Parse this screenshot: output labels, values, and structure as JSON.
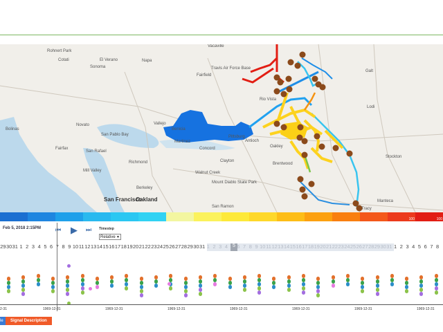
{
  "map": {
    "places": [
      {
        "label": "Rohnert Park"
      },
      {
        "label": "Cotati"
      },
      {
        "label": "El Verano"
      },
      {
        "label": "Sonoma"
      },
      {
        "label": "Napa"
      },
      {
        "label": "Vacaville"
      },
      {
        "label": "Fairfield"
      },
      {
        "label": "Travis Air Force Base"
      },
      {
        "label": "Rio Vista"
      },
      {
        "label": "Galt"
      },
      {
        "label": "Lodi"
      },
      {
        "label": "Benicia"
      },
      {
        "label": "Martinez"
      },
      {
        "label": "Pittsburg"
      },
      {
        "label": "Antioch"
      },
      {
        "label": "Oakley"
      },
      {
        "label": "Brentwood"
      },
      {
        "label": "Stockton"
      },
      {
        "label": "San Pablo Bay"
      },
      {
        "label": "San Rafael"
      },
      {
        "label": "Mill Valley"
      },
      {
        "label": "Richmond"
      },
      {
        "label": "Berkeley"
      },
      {
        "label": "Concord"
      },
      {
        "label": "Clayton"
      },
      {
        "label": "Walnut Creek"
      },
      {
        "label": "Mount Diablo State Park"
      },
      {
        "label": "San Francisco"
      },
      {
        "label": "Oakland"
      },
      {
        "label": "San Ramon"
      },
      {
        "label": "Manteca"
      },
      {
        "label": "Tracy"
      },
      {
        "label": "Bolinas"
      },
      {
        "label": "Fairfax"
      },
      {
        "label": "Novato"
      },
      {
        "label": "Vallejo"
      }
    ]
  },
  "colorbar": {
    "segments": [
      {
        "color": "#1b6fd1",
        "label": ""
      },
      {
        "color": "#1f86e0",
        "label": ""
      },
      {
        "color": "#1fa0ea",
        "label": ""
      },
      {
        "color": "#29b9ef",
        "label": ""
      },
      {
        "color": "#2bc7f2",
        "label": ""
      },
      {
        "color": "#31d2f3",
        "label": ""
      },
      {
        "color": "#f3f6a0",
        "label": ""
      },
      {
        "color": "#fbf25c",
        "label": ""
      },
      {
        "color": "#fde93a",
        "label": ""
      },
      {
        "color": "#fed82a",
        "label": ""
      },
      {
        "color": "#fdbd17",
        "label": ""
      },
      {
        "color": "#fca010",
        "label": ""
      },
      {
        "color": "#f97f10",
        "label": ""
      },
      {
        "color": "#f4581a",
        "label": ""
      },
      {
        "color": "#ec3a1c",
        "label": "100"
      },
      {
        "color": "#e21e14",
        "label": "100"
      }
    ]
  },
  "controls": {
    "date": "Feb 5, 2018 2:15PM",
    "step_back_icon": "step-back-icon",
    "play_icon": "play-icon",
    "step_forward_icon": "step-forward-icon",
    "timestep_label": "Timestep",
    "timestep_value": "Relative"
  },
  "timeline": {
    "days_left": [
      "29",
      "30",
      "31",
      "1",
      "2",
      "3",
      "4",
      "5",
      "6",
      "7",
      "8",
      "9",
      "10",
      "11",
      "12",
      "13",
      "14",
      "15",
      "16",
      "17",
      "18",
      "19",
      "20",
      "21",
      "22",
      "23",
      "24",
      "25",
      "26",
      "27",
      "28",
      "29",
      "30",
      "31"
    ],
    "days_window": [
      "1",
      "2",
      "3",
      "4",
      "5",
      "6",
      "7",
      "8",
      "9",
      "10",
      "11",
      "12",
      "13",
      "14",
      "15",
      "16",
      "17",
      "18",
      "19",
      "20",
      "21",
      "22",
      "23",
      "24",
      "25",
      "26",
      "27",
      "28",
      "29",
      "30",
      "31"
    ],
    "days_right": [
      "1",
      "2",
      "3",
      "4",
      "5",
      "6",
      "7",
      "8"
    ],
    "axis_labels": [
      "2-31",
      "1969-12-31",
      "1969-12-31",
      "1969-12-31",
      "1969-12-31",
      "1969-12-31",
      "1969-12-31",
      "1969-12-31"
    ],
    "columns": [
      {
        "day": "30",
        "dots": [
          "#e2702b",
          "#3aa24a",
          "#2b8ec8",
          "#8bc34a"
        ]
      },
      {
        "day": "1",
        "dots": [
          "#e2702b",
          "#3aa24a",
          "#2b8ec8",
          "#8bc34a",
          "#a36ee0"
        ]
      },
      {
        "day": "2",
        "dots": [
          "#e2702b",
          "#3aa24a",
          "#2b8ec8"
        ]
      },
      {
        "day": "4",
        "dots": [
          "#e2702b",
          "#3aa24a",
          "#2b8ec8",
          "#8bc34a"
        ]
      },
      {
        "day": "6",
        "dots": [
          "#e2702b",
          "#3aa24a",
          "#2b8ec8",
          "#8bc34a",
          "#a36ee0"
        ]
      },
      {
        "day": "9",
        "dots": [
          "#e2702b",
          "#3aa24a",
          "#2b8ec8",
          "#a36ee0",
          "#8bc34a"
        ]
      },
      {
        "day": "11",
        "dots": [
          "#e2702b",
          "#3aa24a",
          "#e57ae0"
        ]
      },
      {
        "day": "13",
        "dots": [
          "#e2702b",
          "#3aa24a",
          "#2b8ec8"
        ]
      }
    ]
  },
  "bottom": {
    "blue_label": "le",
    "orange_label": "Signal Description"
  }
}
